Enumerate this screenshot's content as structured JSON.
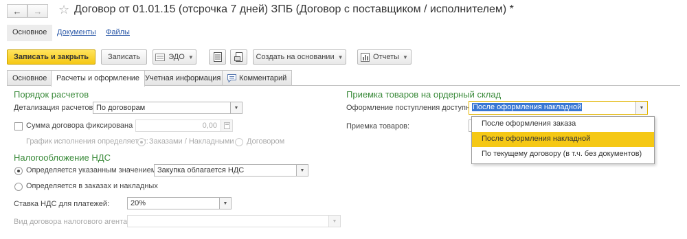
{
  "window": {
    "title": "Договор от 01.01.15 (отсрочка 7 дней) ЗПБ (Договор с поставщиком / исполнителем) *"
  },
  "sections": [
    "Основное",
    "Документы",
    "Файлы"
  ],
  "toolbar": {
    "save_close": "Записать и закрыть",
    "save": "Записать",
    "edo": "ЭДО",
    "create_based": "Создать на основании",
    "reports": "Отчеты"
  },
  "tabs": [
    "Основное",
    "Расчеты и оформление",
    "Учетная информация",
    "Комментарий"
  ],
  "settlement": {
    "heading": "Порядок расчетов",
    "detail_label": "Детализация расчетов:",
    "detail_value": "По договорам",
    "fixed_sum_label": "Сумма договора фиксирована",
    "fixed_sum_value": "0,00",
    "schedule_label": "График исполнения определяется:",
    "schedule_opt1": "Заказами / Накладными",
    "schedule_opt2": "Договором"
  },
  "vat": {
    "heading": "Налогообложение НДС",
    "opt1_label": "Определяется указанным значением",
    "opt1_value": "Закупка облагается НДС",
    "opt2_label": "Определяется в заказах и накладных",
    "rate_label": "Ставка НДС для платежей:",
    "rate_value": "20%",
    "agent_label": "Вид договора налогового агента:"
  },
  "warehouse": {
    "heading": "Приемка товаров на ордерный склад",
    "receipt_label": "Оформление поступления доступно:",
    "receipt_value": "После оформления накладной",
    "acceptance_label": "Приемка товаров:",
    "options": [
      "После оформления заказа",
      "После оформления накладной",
      "По текущему договору (в т.ч. без документов)"
    ]
  },
  "colors": {
    "accent_yellow": "#f5c815",
    "heading_green": "#3a8a3a",
    "link_blue": "#2a58a8",
    "selection_blue": "#3876d4"
  }
}
